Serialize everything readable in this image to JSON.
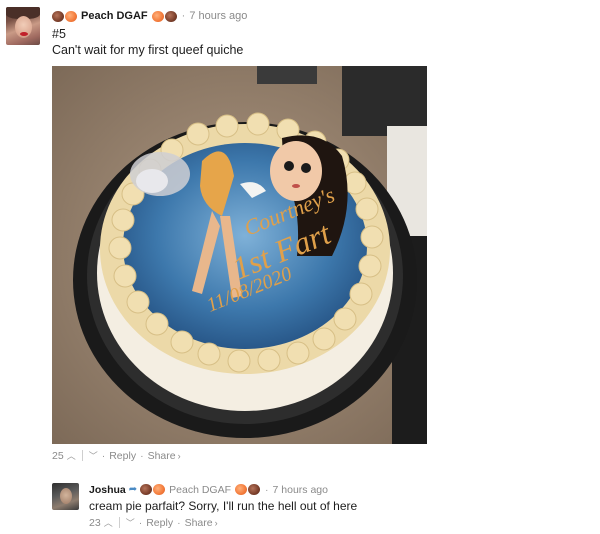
{
  "comment": {
    "author": "Peach DGAF",
    "timestamp": "7 hours ago",
    "lines": [
      "#5",
      "Can't wait for my first queef quiche"
    ],
    "photo_text": {
      "name": "Courtney's",
      "event": "1st Fart",
      "date": "11/08/2020"
    },
    "votes": "25",
    "reply_label": "Reply",
    "share_label": "Share"
  },
  "reply": {
    "author": "Joshua",
    "reply_to": "Peach DGAF",
    "timestamp": "7 hours ago",
    "text": "cream pie parfait? Sorry, I'll run the hell out of here",
    "votes": "23",
    "reply_label": "Reply",
    "share_label": "Share"
  },
  "icons": {
    "upvote": "chevron-up-icon",
    "downvote": "chevron-down-icon",
    "reply_arrow": "reply-arrow-icon",
    "share_arrow": "chevron-right-icon"
  },
  "colors": {
    "accent_link": "#4a8ac4",
    "muted": "#8a8a8a",
    "cake_sky": "#3d78ac",
    "cake_text": "#e0a04a"
  }
}
